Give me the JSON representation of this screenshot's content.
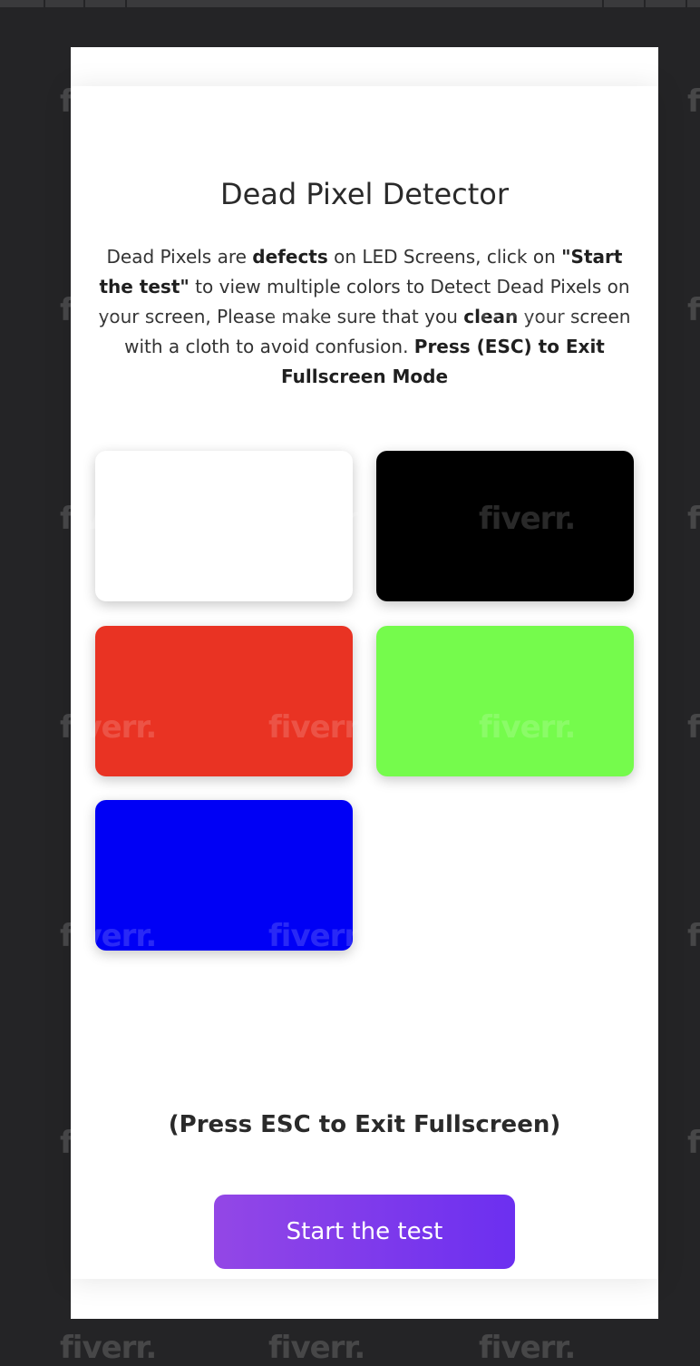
{
  "watermark_text": "fiverr.",
  "detector": {
    "title": "Dead Pixel Detector",
    "description": {
      "p1": "Dead Pixels are ",
      "b1": "defects",
      "p2": " on LED Screens, click on ",
      "b2": "\"Start the test\"",
      "p3": " to view multiple colors to Detect Dead Pixels on your screen, Please make sure that you ",
      "b3": "clean",
      "p4": " your screen with a cloth to avoid confusion. ",
      "b4": "Press (ESC) to Exit Fullscreen Mode"
    },
    "colors": {
      "white": "#ffffff",
      "black": "#000000",
      "red": "#e93323",
      "green": "#75fb4c",
      "blue": "#0000f5"
    },
    "esc_note": "(Press ESC to Exit Fullscreen)",
    "start_button_label": "Start the test",
    "accent_gradient": [
      "#9347e6",
      "#6c2ff0"
    ]
  }
}
